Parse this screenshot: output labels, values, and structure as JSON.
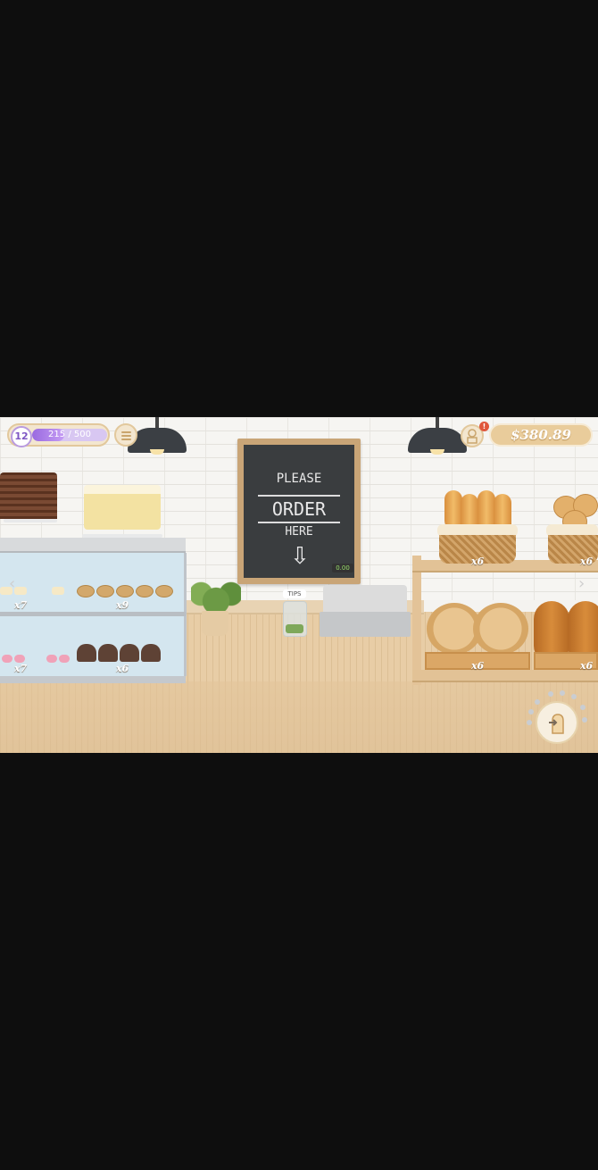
{
  "hud": {
    "level": "12",
    "xp_text": "215 / 500",
    "xp_fraction": 0.43,
    "money": "$380.89",
    "notification_count": "!"
  },
  "chalkboard": {
    "line1": "PLEASE",
    "line2": "ORDER",
    "line3": "HERE",
    "arrow": "⇩"
  },
  "tips": {
    "label": "TIPS"
  },
  "register": {
    "display": "0.00"
  },
  "display_case": {
    "top_left_count": "x7",
    "top_right_count": "x9",
    "bottom_left_count": "x7",
    "bottom_right_count": "x6"
  },
  "bread_shelf": {
    "top_left_count": "x6",
    "top_right_count": "x6",
    "bottom_left_count": "x6",
    "bottom_right_count": "x6"
  },
  "nav": {
    "left": "‹",
    "right": "›"
  },
  "action_icon": "oven-mitt-icon"
}
